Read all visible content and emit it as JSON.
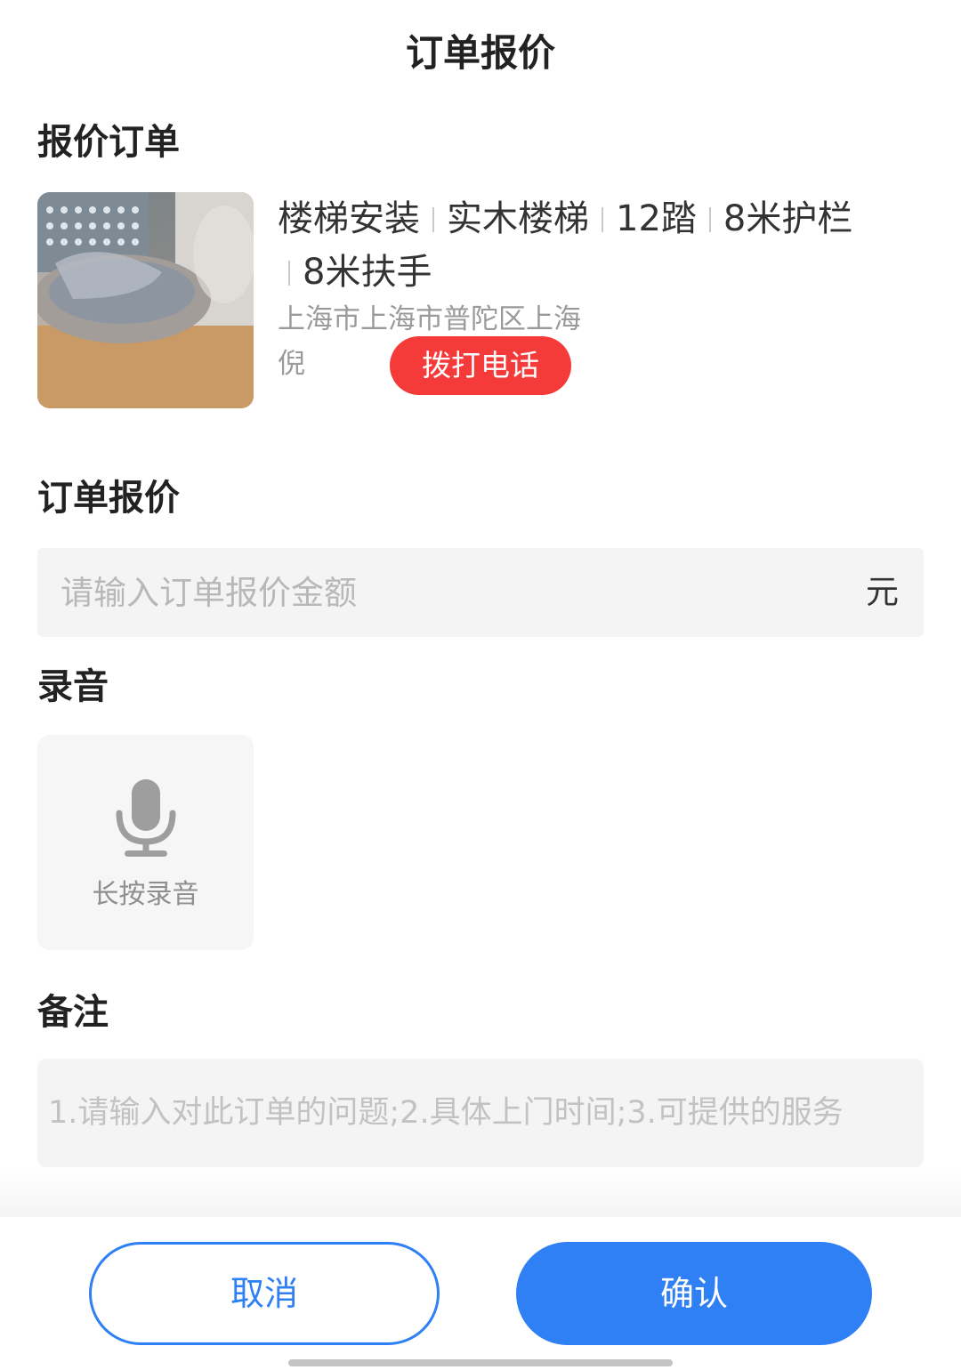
{
  "header": {
    "title": "订单报价"
  },
  "order_section": {
    "title": "报价订单",
    "thumbnail_icon": "stair-photo",
    "tags": [
      "楼梯安装",
      "实木楼梯",
      "12踏",
      "8米护栏",
      "8米扶手"
    ],
    "address": "上海市上海市普陀区上海",
    "contact_name": "倪",
    "call_button_label": "拨打电话"
  },
  "price_section": {
    "title": "订单报价",
    "placeholder": "请输入订单报价金额",
    "value": "",
    "unit": "元"
  },
  "recording_section": {
    "title": "录音",
    "icon": "microphone-icon",
    "hint": "长按录音"
  },
  "remark_section": {
    "title": "备注",
    "placeholder": "1.请输入对此订单的问题;2.具体上门时间;3.可提供的服务",
    "value": ""
  },
  "footer": {
    "cancel_label": "取消",
    "confirm_label": "确认"
  },
  "colors": {
    "primary": "#2f7ff5",
    "danger": "#f53a3a",
    "input_bg": "#f4f4f4"
  }
}
